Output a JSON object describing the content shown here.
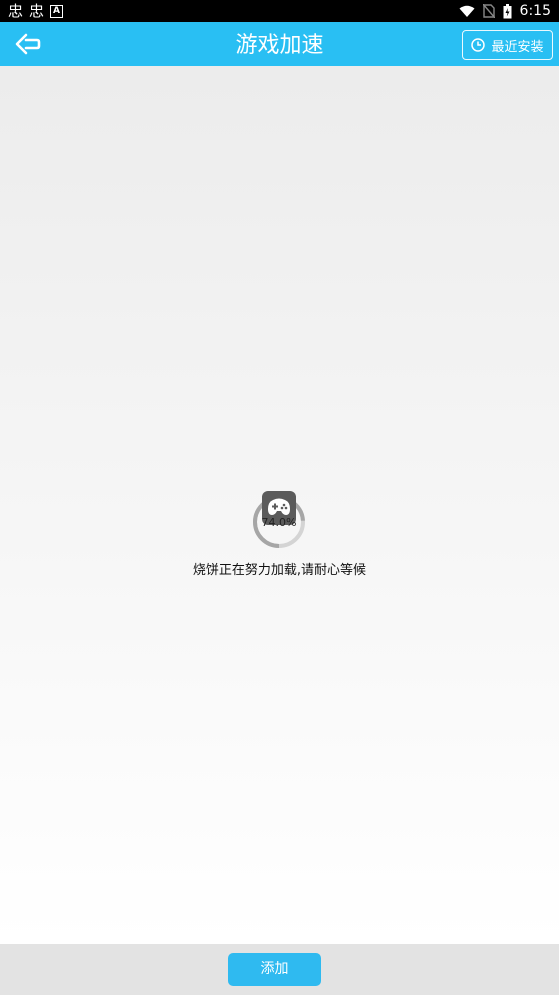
{
  "status_bar": {
    "left_icons": [
      "bug-icon",
      "bug-icon",
      "font-a-icon"
    ],
    "right_icons": [
      "wifi-icon",
      "no-sim-icon",
      "battery-icon"
    ],
    "time": "6:15"
  },
  "header": {
    "title": "游戏加速",
    "recent_label": "最近安装",
    "back_icon": "back-arrow-icon",
    "recent_icon": "clock-icon",
    "color": "#29bff3"
  },
  "loading": {
    "percent_text": "74.0%",
    "progress": 0.74,
    "message": "烧饼正在努力加载,请耐心等候",
    "icon": "gamepad-icon"
  },
  "footer": {
    "add_label": "添加",
    "accent": "#2fbaf0"
  }
}
